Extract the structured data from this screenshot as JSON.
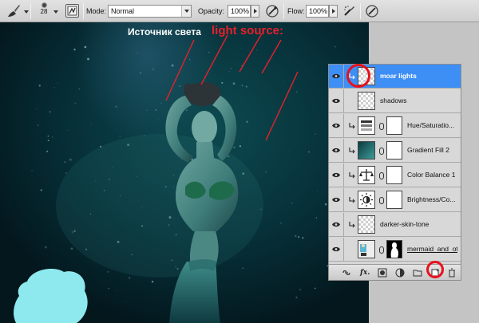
{
  "options_bar": {
    "brush_size": "28",
    "mode_label": "Mode:",
    "mode_value": "Normal",
    "opacity_label": "Opacity:",
    "opacity_value": "100%",
    "flow_label": "Flow:",
    "flow_value": "100%"
  },
  "canvas": {
    "caption_ru": "Источник света",
    "caption_en": "light source:",
    "stroke_color": "#e8202a",
    "blob_color": "#8ee9ee"
  },
  "layers": [
    {
      "name": "moar lights",
      "selected": true,
      "thumb": "checker",
      "clipped": true,
      "mask": false
    },
    {
      "name": "shadows",
      "selected": false,
      "thumb": "checker",
      "clipped": false,
      "mask": false
    },
    {
      "name": "Hue/Saturatio...",
      "selected": false,
      "thumb": "hue-sat",
      "clipped": true,
      "mask": true
    },
    {
      "name": "Gradient Fill 2",
      "selected": false,
      "thumb": "gradient",
      "clipped": true,
      "mask": true
    },
    {
      "name": "Color Balance 1",
      "selected": false,
      "thumb": "balance",
      "clipped": true,
      "mask": true
    },
    {
      "name": "Brightness/Co...",
      "selected": false,
      "thumb": "brightness",
      "clipped": true,
      "mask": true
    },
    {
      "name": "darker-skin-tone",
      "selected": false,
      "thumb": "checker",
      "clipped": true,
      "mask": false
    },
    {
      "name": "mermaid_and_othe...",
      "selected": false,
      "thumb": "photo",
      "clipped": false,
      "mask": true
    }
  ],
  "footer_icons": [
    "link-icon",
    "fx-icon",
    "add-mask-icon",
    "adjustment-icon",
    "group-folder-icon",
    "new-layer-icon",
    "trash-icon"
  ],
  "colors": {
    "selection_blue": "#3d8ef5",
    "annotation_red": "#e8101c"
  }
}
